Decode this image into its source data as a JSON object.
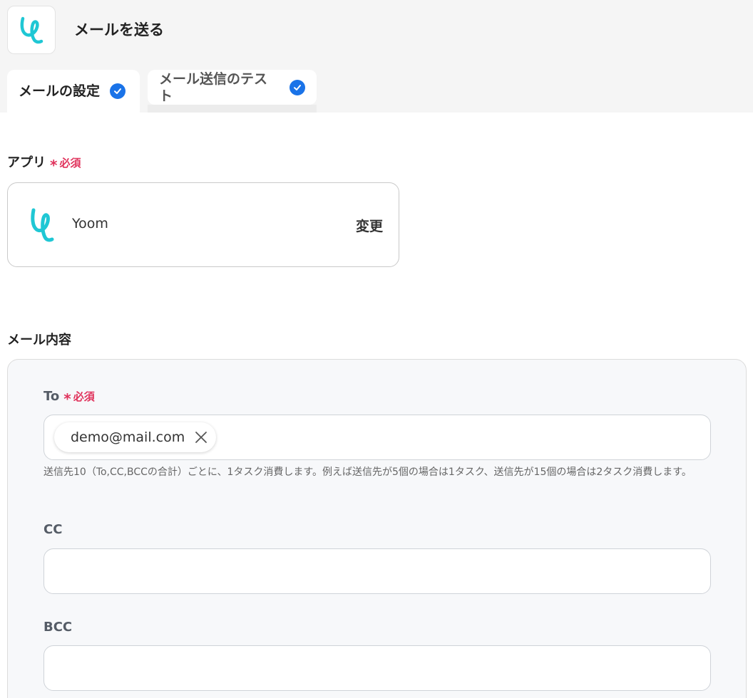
{
  "header": {
    "title": "メールを送る"
  },
  "tabs": [
    {
      "label": "メールの設定",
      "completed": true
    },
    {
      "label": "メール送信のテスト",
      "completed": true
    }
  ],
  "app_section": {
    "label": "アプリ",
    "required_label": "必須",
    "app_name": "Yoom",
    "change_label": "変更"
  },
  "mail_section": {
    "label": "メール内容",
    "to": {
      "label": "To",
      "required_label": "必須",
      "chips": [
        "demo@mail.com"
      ],
      "help": "送信先10（To,CC,BCCの合計）ごとに、1タスク消費します。例えば送信先が5個の場合は1タスク、送信先が15個の場合は2タスク消費します。"
    },
    "cc": {
      "label": "CC",
      "value": ""
    },
    "bcc": {
      "label": "BCC",
      "value": ""
    }
  },
  "colors": {
    "accent": "#1a73e8",
    "required": "#e0335c",
    "logo_teal": "#1fc7d4"
  }
}
